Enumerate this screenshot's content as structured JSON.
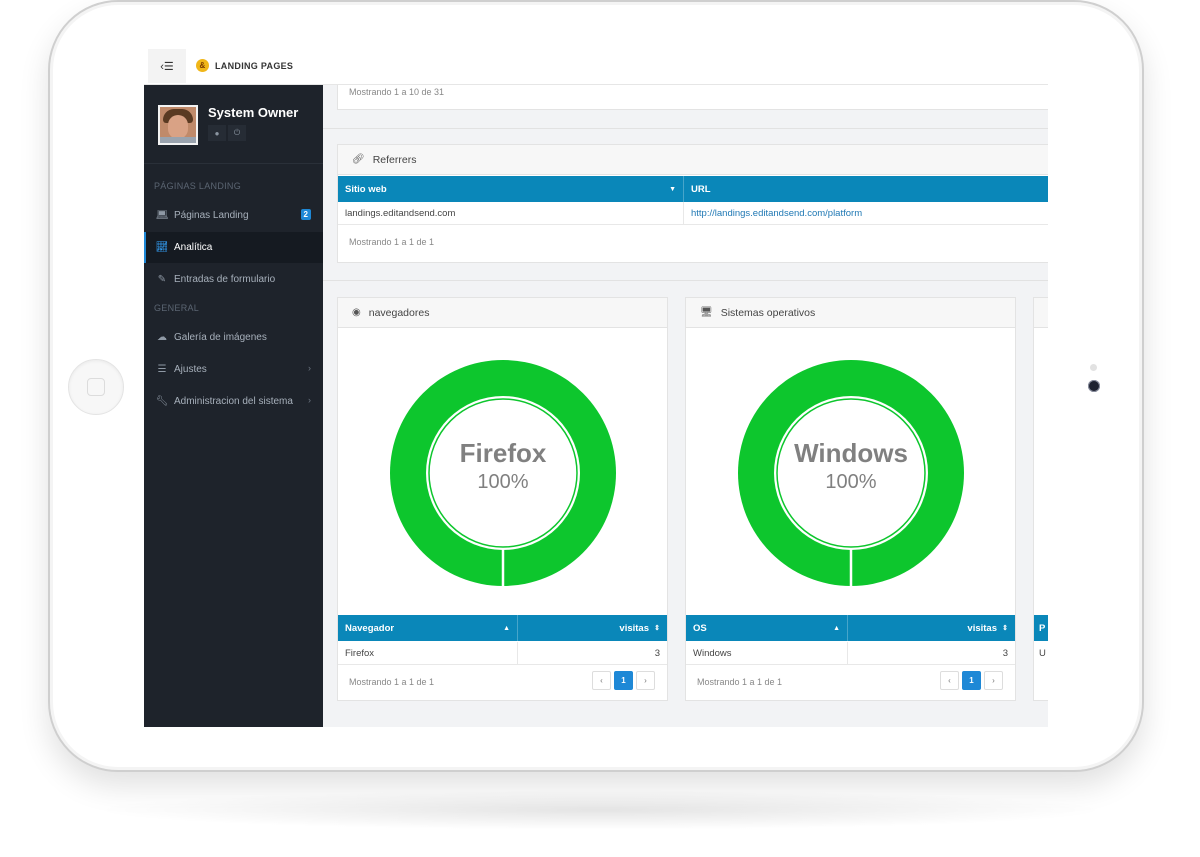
{
  "app": {
    "brand": "LANDING PAGES",
    "logo_glyph": "&"
  },
  "profile": {
    "name": "System Owner"
  },
  "sidebar": {
    "section1": "PÁGINAS LANDING",
    "section2": "GENERAL",
    "items": [
      {
        "label": "Páginas Landing",
        "icon": "laptop-icon",
        "badge": "2"
      },
      {
        "label": "Analítica",
        "icon": "chart-line-icon",
        "active": true
      },
      {
        "label": "Entradas de formulario",
        "icon": "edit-icon"
      },
      {
        "label": "Galería de imágenes",
        "icon": "cloud-icon"
      },
      {
        "label": "Ajustes",
        "icon": "sliders-icon",
        "chevron": true
      },
      {
        "label": "Administracion del sistema",
        "icon": "wrench-icon",
        "chevron": true
      }
    ]
  },
  "top_panel": {
    "info": "Mostrando 1 a 10 de 31"
  },
  "referrers": {
    "title": "Referrers",
    "columns": [
      "Sitio web",
      "URL"
    ],
    "rows": [
      [
        "landings.editandsend.com",
        "http://landings.editandsend.com/platform"
      ]
    ],
    "info": "Mostrando 1 a 1 de 1"
  },
  "browsers": {
    "title": "navegadores",
    "chart_label": "Firefox",
    "chart_pct": "100%",
    "columns": [
      "Navegador",
      "visitas"
    ],
    "rows": [
      [
        "Firefox",
        "3"
      ]
    ],
    "info": "Mostrando 1 a 1 de 1",
    "page": "1"
  },
  "os": {
    "title": "Sistemas operativos",
    "chart_label": "Windows",
    "chart_pct": "100%",
    "columns": [
      "OS",
      "visitas"
    ],
    "rows": [
      [
        "Windows",
        "3"
      ]
    ],
    "info": "Mostrando 1 a 1 de 1",
    "page": "1"
  },
  "partial_panel": {
    "header_fragment": "P",
    "row_fragment": "U"
  },
  "colors": {
    "accent": "#0a87b9",
    "donut": "#0dc62d",
    "sidebar": "#1e232b",
    "active_link": "#1e88d6"
  }
}
